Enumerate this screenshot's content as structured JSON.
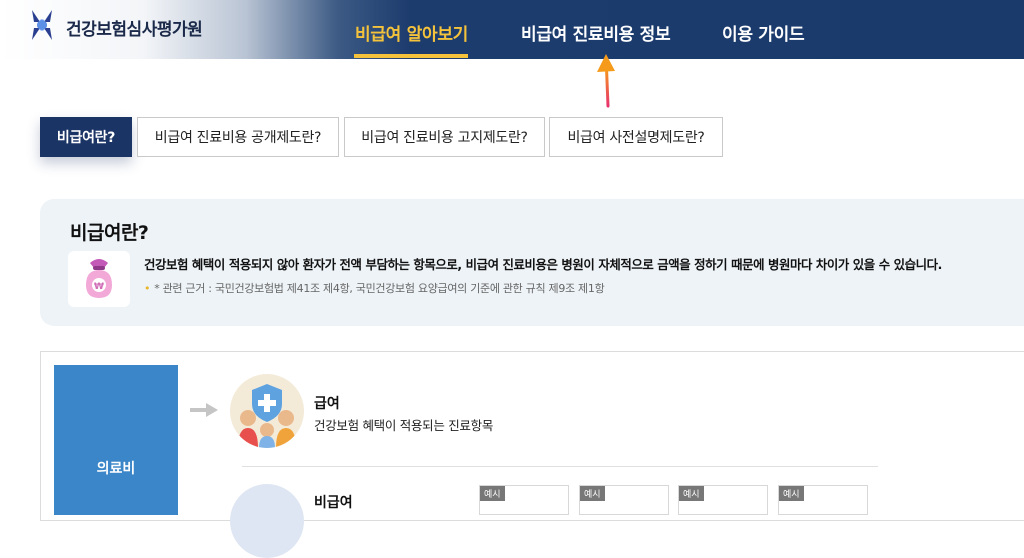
{
  "header": {
    "brand": "건강보험심사평가원",
    "nav": [
      {
        "label": "비급여 알아보기",
        "active": true
      },
      {
        "label": "비급여 진료비용 정보",
        "active": false
      },
      {
        "label": "이용 가이드",
        "active": false
      }
    ]
  },
  "tabs": [
    {
      "label": "비급여란?",
      "active": true
    },
    {
      "label": "비급여 진료비용 공개제도란?",
      "active": false
    },
    {
      "label": "비급여 진료비용 고지제도란?",
      "active": false
    },
    {
      "label": "비급여 사전설명제도란?",
      "active": false
    }
  ],
  "info": {
    "title": "비급여란?",
    "description": "건강보험 혜택이 적용되지 않아 환자가 전액 부담하는 항목으로, 비급여 진료비용은 병원이 자체적으로 금액을 정하기 때문에 병원마다 차이가 있을 수 있습니다.",
    "note": "* 관련 근거 : 국민건강보험법 제41조 제4항, 국민건강보험 요양급여의 기준에 관한 규칙 제9조 제1항"
  },
  "diagram": {
    "category": "의료비",
    "benefit": {
      "title": "급여",
      "desc": "건강보험 혜택이 적용되는 진료항목"
    },
    "non_benefit": {
      "title": "비급여"
    },
    "example_badge": "예시"
  },
  "colors": {
    "header_navy": "#1a3a6c",
    "accent_yellow": "#f5c33b",
    "tab_active": "#1a3466",
    "category_blue": "#3a86c8"
  }
}
